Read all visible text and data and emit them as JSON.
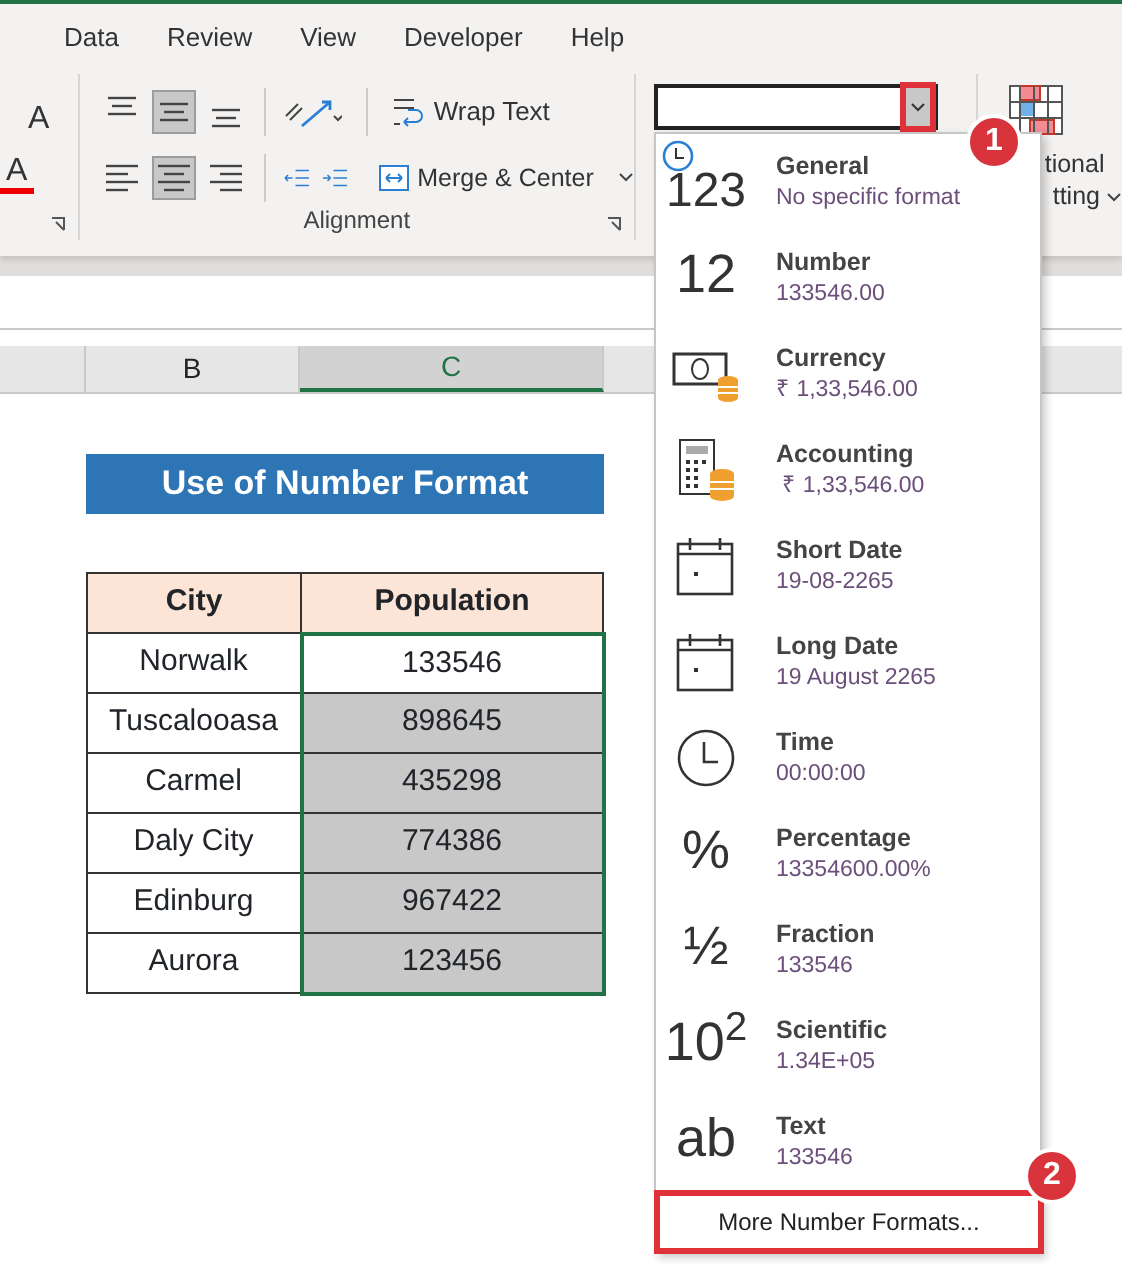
{
  "ribbon": {
    "tabs": [
      {
        "label": "Data"
      },
      {
        "label": "Review"
      },
      {
        "label": "View"
      },
      {
        "label": "Developer"
      },
      {
        "label": "Help"
      }
    ],
    "font_group": {
      "grow_glyph": "A",
      "color_glyph": "A"
    },
    "alignment_group": {
      "label": "Alignment",
      "buttons": [
        {
          "kind": "top",
          "pressed": false
        },
        {
          "kind": "middle",
          "pressed": true
        },
        {
          "kind": "bottom",
          "pressed": false
        },
        {
          "kind": "left",
          "pressed": false
        },
        {
          "kind": "center",
          "pressed": true
        },
        {
          "kind": "right",
          "pressed": false
        }
      ],
      "wrap_text": "Wrap Text",
      "merge_center": "Merge & Center"
    },
    "conditional_formatting": {
      "line_1": "tional",
      "line_2": "tting"
    }
  },
  "column_headers": [
    {
      "label": "B",
      "selected": false
    },
    {
      "label": "C",
      "selected": true
    }
  ],
  "sheet": {
    "title": "Use of Number Format",
    "headers": [
      "City",
      "Population"
    ],
    "rows": [
      {
        "city": "Norwalk",
        "population": "133546",
        "active": true
      },
      {
        "city": "Tuscalooasa",
        "population": "898645",
        "active": false
      },
      {
        "city": "Carmel",
        "population": "435298",
        "active": false
      },
      {
        "city": "Daly City",
        "population": "774386",
        "active": false
      },
      {
        "city": "Edinburg",
        "population": "967422",
        "active": false
      },
      {
        "city": "Aurora",
        "population": "123456",
        "active": false
      }
    ]
  },
  "format_menu": {
    "items": [
      {
        "kind": "clock-glyph",
        "glyph": "123",
        "title": "General",
        "sample": "No specific format"
      },
      {
        "kind": "glyph",
        "glyph": "12",
        "title": "Number",
        "sample": "133546.00"
      },
      {
        "kind": "bill",
        "title": "Currency",
        "sample": "₹ 1,33,546.00"
      },
      {
        "kind": "calculator",
        "title": "Accounting",
        "sample": " ₹ 1,33,546.00"
      },
      {
        "kind": "calendar",
        "title": "Short Date",
        "sample": "19-08-2265"
      },
      {
        "kind": "calendar",
        "title": "Long Date",
        "sample": "19 August 2265"
      },
      {
        "kind": "clock",
        "title": "Time",
        "sample": "00:00:00"
      },
      {
        "kind": "glyph",
        "glyph": "%",
        "title": "Percentage",
        "sample": "13354600.00%"
      },
      {
        "kind": "glyph",
        "glyph": "½",
        "title": "Fraction",
        "sample": "133546"
      },
      {
        "kind": "glyph",
        "glyph": "10$^{2}$",
        "title": "Scientific",
        "sample": "1.34E+05"
      },
      {
        "kind": "glyph",
        "glyph": "ab",
        "title": "Text",
        "sample": "133546"
      }
    ],
    "footer": "More Number Formats..."
  },
  "callouts": [
    "1",
    "2"
  ]
}
